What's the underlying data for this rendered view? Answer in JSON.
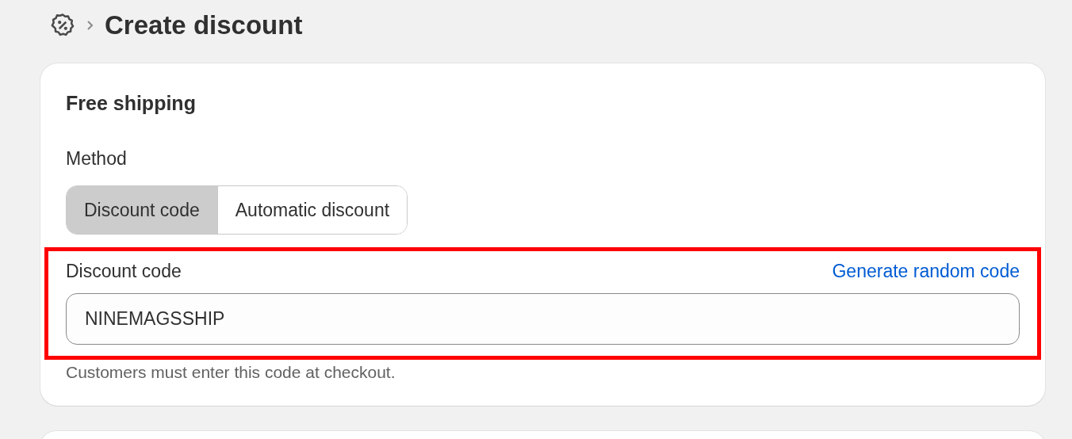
{
  "breadcrumb": {
    "title": "Create discount"
  },
  "card": {
    "title": "Free shipping",
    "method": {
      "label": "Method",
      "options": [
        {
          "label": "Discount code",
          "selected": true
        },
        {
          "label": "Automatic discount",
          "selected": false
        }
      ]
    },
    "code_field": {
      "label": "Discount code",
      "link": "Generate random code",
      "value": "NINEMAGSSHIP",
      "highlighted": true,
      "hint": "Customers must enter this code at checkout."
    }
  }
}
